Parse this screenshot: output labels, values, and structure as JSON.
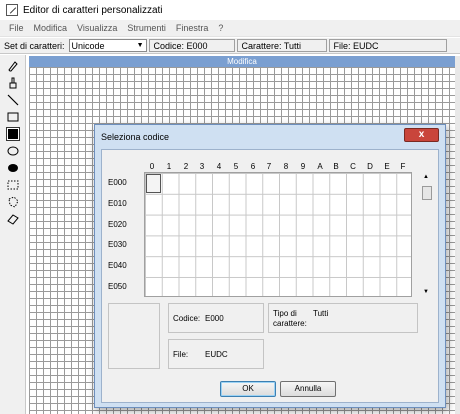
{
  "window": {
    "title": "Editor di caratteri personalizzati"
  },
  "menu": [
    "File",
    "Modifica",
    "Visualizza",
    "Strumenti",
    "Finestra",
    "?"
  ],
  "infobar": {
    "charset_label": "Set di caratteri:",
    "charset_value": "Unicode",
    "code_field": "Codice: E000",
    "char_field": "Carattere: Tutti",
    "file_field": "File: EUDC"
  },
  "tools": [
    "pencil-tool-icon",
    "brush-tool-icon",
    "line-tool-icon",
    "hollow-rectangle-tool-icon",
    "filled-rectangle-tool-icon",
    "hollow-ellipse-tool-icon",
    "filled-ellipse-tool-icon",
    "rect-select-tool-icon",
    "freeform-select-tool-icon",
    "eraser-tool-icon"
  ],
  "editor": {
    "header": "Modifica"
  },
  "dialog": {
    "title": "Seleziona codice",
    "close": "x",
    "columns": [
      "0",
      "1",
      "2",
      "3",
      "4",
      "5",
      "6",
      "7",
      "8",
      "9",
      "A",
      "B",
      "C",
      "D",
      "E",
      "F"
    ],
    "rows": [
      "E000",
      "E010",
      "E020",
      "E030",
      "E040",
      "E050"
    ],
    "code_label": "Codice:",
    "code_value": "E000",
    "type_label": "Tipo di carattere:",
    "type_value": "Tutti",
    "file_label": "File:",
    "file_value": "EUDC",
    "ok": "OK",
    "cancel": "Annulla"
  }
}
